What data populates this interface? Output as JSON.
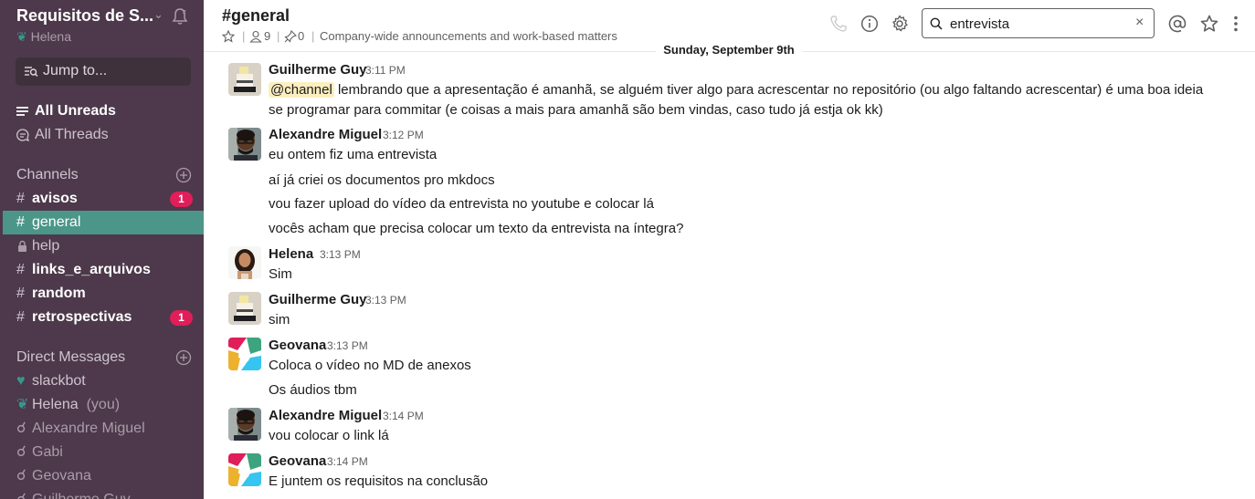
{
  "workspace": {
    "name": "Requisitos de S...",
    "user": "Helena"
  },
  "jump": {
    "label": "Jump to..."
  },
  "nav": {
    "all_unreads": "All Unreads",
    "all_threads": "All Threads"
  },
  "channels": {
    "header": "Channels",
    "items": [
      {
        "name": "avisos",
        "unread": true,
        "badge": "1"
      },
      {
        "name": "general",
        "active": true
      },
      {
        "name": "help",
        "private": true
      },
      {
        "name": "links_e_arquivos",
        "unread": true
      },
      {
        "name": "random",
        "unread": true
      },
      {
        "name": "retrospectivas",
        "unread": true,
        "badge": "1"
      }
    ]
  },
  "dms": {
    "header": "Direct Messages",
    "items": [
      {
        "name": "slackbot"
      },
      {
        "name": "Helena",
        "suffix": "(you)"
      },
      {
        "name": "Alexandre Miguel"
      },
      {
        "name": "Gabi"
      },
      {
        "name": "Geovana"
      },
      {
        "name": "Guilherme Guy"
      }
    ]
  },
  "channel": {
    "title": "#general",
    "members": "9",
    "pins": "0",
    "topic": "Company-wide announcements and work-based matters"
  },
  "search": {
    "value": "entrevista",
    "clear": "×"
  },
  "date_divider": "Sunday, September 9th",
  "messages": [
    {
      "author": "Guilherme Guy",
      "time": "3:11 PM",
      "mention": "@channel",
      "lines": [
        "lembrando que a apresentação é amanhã, se alguém tiver algo para acrescentar no repositório (ou algo faltando acrescentar) é uma boa ideia se programar para commitar (e coisas a mais para amanhã são bem vindas, caso tudo já estja ok kk)"
      ]
    },
    {
      "author": "Alexandre Miguel",
      "time": "3:12 PM",
      "lines": [
        "eu ontem fiz uma entrevista",
        "aí já criei os documentos pro mkdocs",
        "vou fazer upload do vídeo da entrevista no youtube e colocar lá",
        "vocês acham que precisa colocar um texto da entrevista na íntegra?"
      ]
    },
    {
      "author": "Helena",
      "time": "3:13 PM",
      "lines": [
        "Sim"
      ]
    },
    {
      "author": "Guilherme Guy",
      "time": "3:13 PM",
      "lines": [
        "sim"
      ]
    },
    {
      "author": "Geovana",
      "time": "3:13 PM",
      "lines": [
        "Coloca o vídeo no MD de anexos",
        "Os áudios tbm"
      ]
    },
    {
      "author": "Alexandre Miguel",
      "time": "3:14 PM",
      "lines": [
        "vou colocar o link lá"
      ]
    },
    {
      "author": "Geovana",
      "time": "3:14 PM",
      "lines": [
        "E juntem os requisitos na conclusão"
      ]
    }
  ],
  "colors": {
    "sidebar": "#4d394b",
    "active": "#4c9689",
    "badge": "#e01e5a",
    "presence": "#38978d"
  }
}
